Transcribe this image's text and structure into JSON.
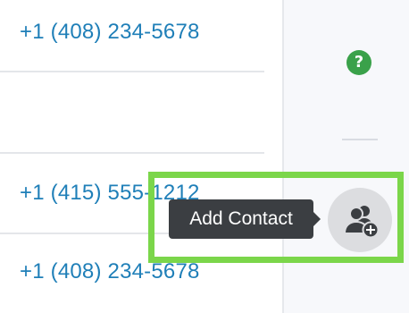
{
  "contacts": {
    "rows": [
      {
        "phone": "+1 (408) 234-5678"
      },
      {
        "phone": ""
      },
      {
        "phone": "+1 (415) 555-1212"
      },
      {
        "phone": "+1 (408) 234-5678"
      }
    ]
  },
  "right_panel": {
    "help_icon": "help-icon",
    "help_glyph": "?"
  },
  "add_contact": {
    "tooltip": "Add Contact",
    "icon": "add-contact-icon"
  },
  "colors": {
    "phone_link": "#1f7fb8",
    "help_green": "#3aa14a",
    "highlight_green": "#7bd64a",
    "tooltip_bg": "#3b3e42"
  }
}
